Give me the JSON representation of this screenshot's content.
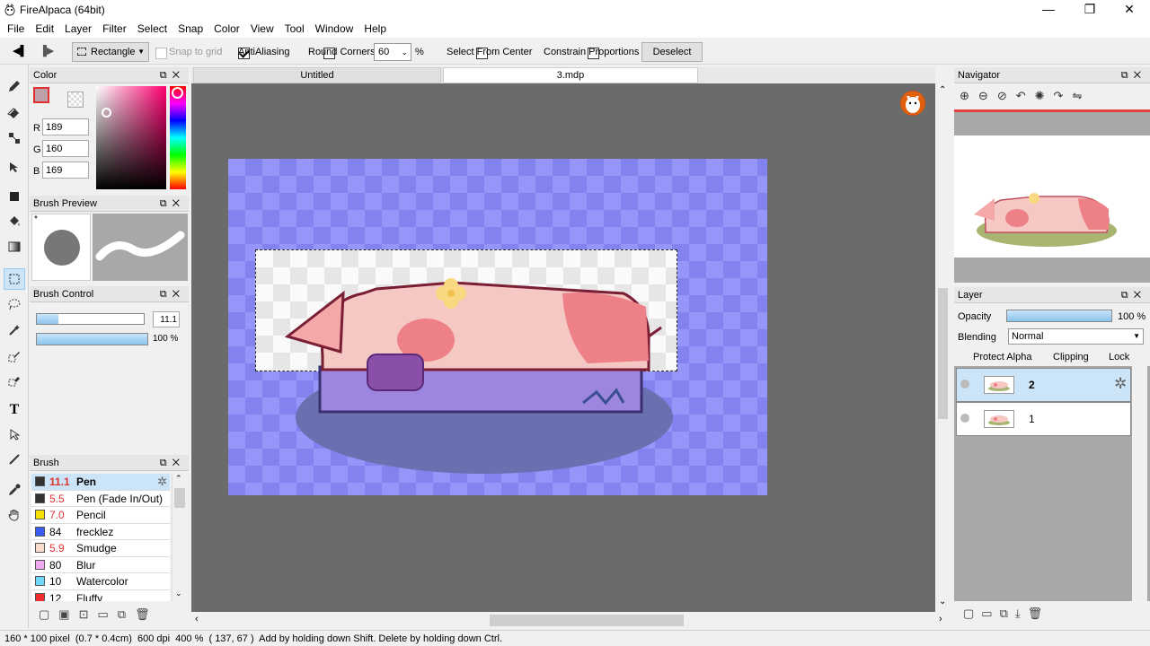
{
  "window": {
    "title": "FireAlpaca (64bit)",
    "controls": {
      "minimize": "—",
      "maximize": "❐",
      "close": "✕"
    }
  },
  "menu": [
    "File",
    "Edit",
    "Layer",
    "Filter",
    "Select",
    "Snap",
    "Color",
    "View",
    "Tool",
    "Window",
    "Help"
  ],
  "toolbar": {
    "shape_select": "Rectangle",
    "snap_to_grid": "Snap to grid",
    "antialiasing": "AntiAliasing",
    "round_corners": "Round Corners",
    "corner_value": "60",
    "percent": "%",
    "select_from_center": "Select From Center",
    "constrain_proportions": "Constrain Proportions",
    "deselect": "Deselect"
  },
  "color_panel": {
    "title": "Color",
    "r_label": "R",
    "r": "189",
    "g_label": "G",
    "g": "160",
    "b_label": "B",
    "b": "169",
    "primary_hex": "#bda0a9"
  },
  "brush_preview": {
    "title": "Brush Preview",
    "marker": "*"
  },
  "brush_control": {
    "title": "Brush Control",
    "size": "11.1",
    "opacity": "100 %",
    "size_fraction": 0.2,
    "opacity_fraction": 1.0
  },
  "brush_panel": {
    "title": "Brush",
    "items": [
      {
        "size": "11.1",
        "name": "Pen",
        "color": "#333333",
        "active": true
      },
      {
        "size": "5.5",
        "name": "Pen (Fade In/Out)",
        "color": "#333333"
      },
      {
        "size": "7.0",
        "name": "Pencil",
        "color": "#f5e000"
      },
      {
        "size": "84",
        "name": "frecklez",
        "color": "#3a5bf0"
      },
      {
        "size": "5.9",
        "name": "Smudge",
        "color": "#fadccd"
      },
      {
        "size": "80",
        "name": "Blur",
        "color": "#f0a8f0"
      },
      {
        "size": "10",
        "name": "Watercolor",
        "color": "#70d8f8"
      },
      {
        "size": "12",
        "name": "Fluffy",
        "color": "#f03030"
      }
    ]
  },
  "tabs": [
    {
      "label": "Untitled",
      "active": false
    },
    {
      "label": "3.mdp",
      "active": true
    }
  ],
  "navigator": {
    "title": "Navigator"
  },
  "layer_panel": {
    "title": "Layer",
    "opacity_label": "Opacity",
    "opacity_value": "100 %",
    "blending_label": "Blending",
    "blending_value": "Normal",
    "protect_alpha": "Protect Alpha",
    "clipping": "Clipping",
    "lock": "Lock",
    "layers": [
      {
        "name": "2",
        "selected": true
      },
      {
        "name": "1",
        "selected": false
      }
    ]
  },
  "status": {
    "text": "160 * 100 pixel  (0.7 * 0.4cm)  600 dpi  400 %  ( 137, 67 )  Add by holding down Shift. Delete by holding down Ctrl."
  }
}
